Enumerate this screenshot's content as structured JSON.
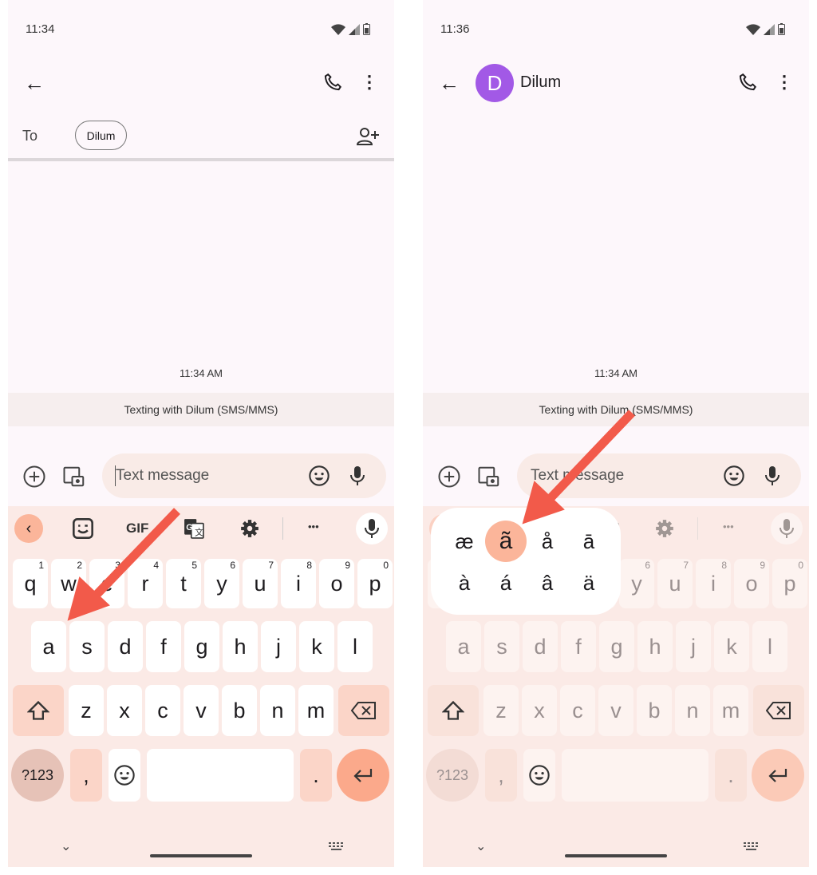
{
  "panels": [
    {
      "time": "11:34",
      "contact": "",
      "to_label": "To",
      "recipient_chip": "Dilum",
      "timestamp": "11:34 AM",
      "banner": "Texting with Dilum (SMS/MMS)",
      "placeholder": "Text message",
      "dimmed": false
    },
    {
      "time": "11:36",
      "contact": "Dilum",
      "avatar_letter": "D",
      "timestamp": "11:34 AM",
      "banner": "Texting with Dilum (SMS/MMS)",
      "placeholder": "Text message",
      "dimmed": true,
      "accent_popup": {
        "row1": [
          "æ",
          "ã",
          "å",
          "ā"
        ],
        "row2": [
          "à",
          "á",
          "â",
          "ä"
        ],
        "selected": "ã"
      }
    }
  ],
  "keyboard": {
    "toolbar": {
      "gif": "GIF",
      "more": "•••"
    },
    "row1": [
      "q",
      "w",
      "e",
      "r",
      "t",
      "y",
      "u",
      "i",
      "o",
      "p"
    ],
    "row1_hints": [
      "1",
      "2",
      "3",
      "4",
      "5",
      "6",
      "7",
      "8",
      "9",
      "0"
    ],
    "row2": [
      "a",
      "s",
      "d",
      "f",
      "g",
      "h",
      "j",
      "k",
      "l"
    ],
    "row3": [
      "z",
      "x",
      "c",
      "v",
      "b",
      "n",
      "m"
    ],
    "symbols": "?123",
    "comma": ",",
    "period": "."
  },
  "colors": {
    "accent": "#fbb59a",
    "arrow": "#f25a4a",
    "avatar": "#a259e6",
    "keyboard_bg": "#fbeae6"
  }
}
